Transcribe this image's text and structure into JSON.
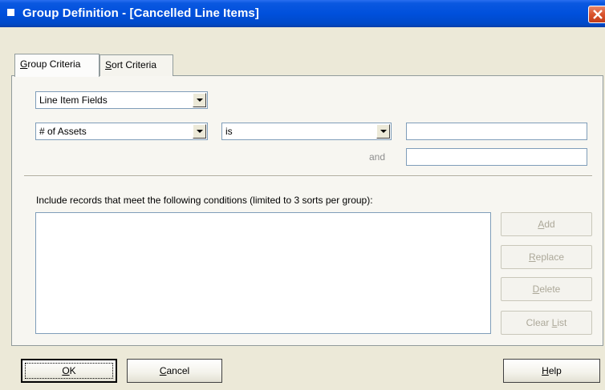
{
  "window": {
    "title": "Group Definition - [Cancelled Line Items]"
  },
  "tabs": [
    {
      "label_u": "G",
      "label_rest": "roup Criteria"
    },
    {
      "label_u": "S",
      "label_rest": "ort Criteria"
    }
  ],
  "criteria": {
    "field_category": "Line Item Fields",
    "field": "# of Assets",
    "operator": "is",
    "value1": "",
    "value2": "",
    "and_label": "and"
  },
  "conditions": {
    "label": "Include records that meet the following conditions (limited to 3 sorts per group):",
    "items": []
  },
  "side_buttons": {
    "add_u": "A",
    "add_rest": "dd",
    "replace_u": "R",
    "replace_rest": "eplace",
    "delete_u": "D",
    "delete_rest": "elete",
    "clear_pre": "Clear ",
    "clear_u": "L",
    "clear_rest": "ist"
  },
  "footer": {
    "ok_u": "O",
    "ok_rest": "K",
    "cancel_u": "C",
    "cancel_rest": "ancel",
    "help_u": "H",
    "help_rest": "elp"
  }
}
